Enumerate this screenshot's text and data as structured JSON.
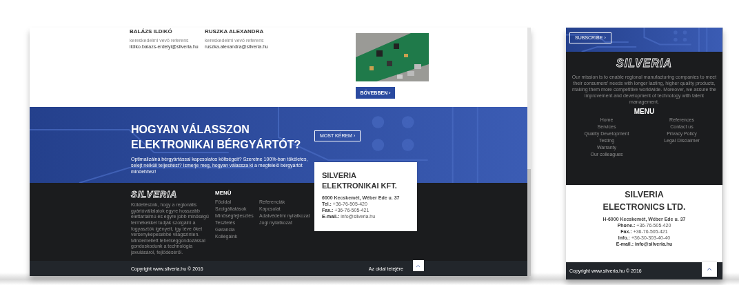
{
  "desktop": {
    "contacts": [
      {
        "name": "BALÁZS ILDIKÓ",
        "role": "kereskedelmi vevő referens",
        "email": "ildiko.balazs-erdelyi@silveria.hu"
      },
      {
        "name": "RUSZKA ALEXANDRA",
        "role": "kereskedelmi vevő referens",
        "email": "ruszka.alexandra@silveria.hu"
      }
    ],
    "more_button": "BŐVEBBEN ›",
    "banner": {
      "title_lines": [
        "HOGYAN VÁLASSZON",
        "ELEKTRONIKAI BÉRGYÁRTÓT?"
      ],
      "text": "Optimalizálná bérgyártással kapcsolatos költségeit? Szeretne 100%-ban tökéletes, selejt nélküli teljesítést? Ismerje meg, hogyan válassza ki a megfelelő bérgyártót mindehhez!",
      "button": "MOST KÉREM ›"
    },
    "company": {
      "name_lines": [
        "SILVERIA",
        "ELEKTRONIKAI KFT."
      ],
      "address": "6000 Kecskemét, Wéber Ede u. 37",
      "lines": [
        "**Tel.:** +36-76-505-420",
        "**Fax.:** +36-76-505-421",
        "**E-mail.:** info@silveria.hu"
      ]
    },
    "footer": {
      "logo": "SILVERIA",
      "mission": "Küldetésünk, hogy a regionális gyártóvállalatok egyre hosszabb élettartalmú és egyre jobb minőségű termékekkel tudják szolgálni a fogyasztók igényeit, így téve őket versenyképesebbé világszinten. Mindemellett tehetséggondozással gondoskodunk a technológia javulásáról, fejlődéséről.",
      "menu_title": "MENÜ",
      "menu_columns": [
        [
          "Főoldal",
          "Szolgáltatások",
          "Minőségfejlesztés",
          "Tesztelés",
          "Garancia",
          "Kollégáink"
        ],
        [
          "Referenciák",
          "Kapcsolat",
          "Adatvédelmi nyilatkozat",
          "Jogi nyilatkozat"
        ]
      ]
    },
    "copyright": "Copyright www.silveria.hu © 2016",
    "back_to_top": "Az oldal tetejére"
  },
  "mobile": {
    "subscribe": "SUBSCRIBE ›",
    "logo": "SILVERIA",
    "mission": "Our mission is to enable regional manufacturing companies to meet their consumers' needs with longer lasting, higher quality products, making them more competitive worldwide. Moreover, we assure the improvement and development of technology with talent management.",
    "menu_title": "MENU",
    "menu_columns": [
      [
        "Home",
        "Services",
        "Quality Development",
        "Testing",
        "Warranty",
        "Our colleagues"
      ],
      [
        "References",
        "Contact us",
        "Privacy Policy",
        "Legal Disclaimer"
      ]
    ],
    "company": {
      "name_lines": [
        "SILVERIA",
        "ELECTRONICS LTD."
      ],
      "address": "H-6000 Kecskemét, Wéber Ede u. 37",
      "lines": [
        "**Phone.:** +36-76-505-420",
        "**Fax.:** +36-76-505-421",
        "**Info.:** +36-30-303-40-40",
        "**E-mail.:** **info@silveria.hu**"
      ]
    },
    "copyright": "Copyright www.silveria.hu © 2016"
  }
}
